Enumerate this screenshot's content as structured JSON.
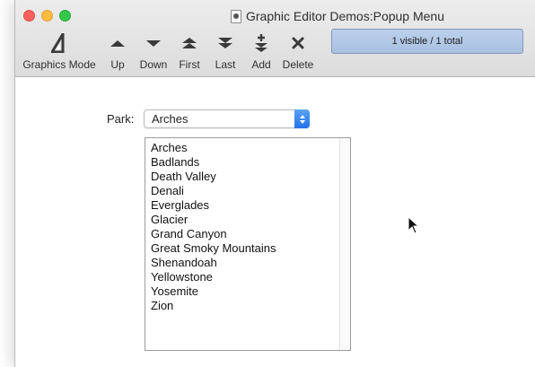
{
  "window": {
    "title": "Graphic Editor Demos:Popup Menu"
  },
  "toolbar": {
    "items": [
      {
        "label": "Graphics Mode",
        "icon": "set-square-icon"
      },
      {
        "label": "Up",
        "icon": "triangle-up-icon"
      },
      {
        "label": "Down",
        "icon": "triangle-down-icon"
      },
      {
        "label": "First",
        "icon": "double-up-icon"
      },
      {
        "label": "Last",
        "icon": "double-down-icon"
      },
      {
        "label": "Add",
        "icon": "plus-icon"
      },
      {
        "label": "Delete",
        "icon": "x-icon"
      }
    ],
    "status": "1 visible / 1 total"
  },
  "form": {
    "park_label": "Park:",
    "park_selected": "Arches",
    "parks": [
      "Arches",
      "Badlands",
      "Death Valley",
      "Denali",
      "Everglades",
      "Glacier",
      "Grand Canyon",
      "Great Smoky Mountains",
      "Shenandoah",
      "Yellowstone",
      "Yosemite",
      "Zion"
    ]
  },
  "colors": {
    "status_fill": "#a9c0e2",
    "accent": "#2371e6"
  }
}
